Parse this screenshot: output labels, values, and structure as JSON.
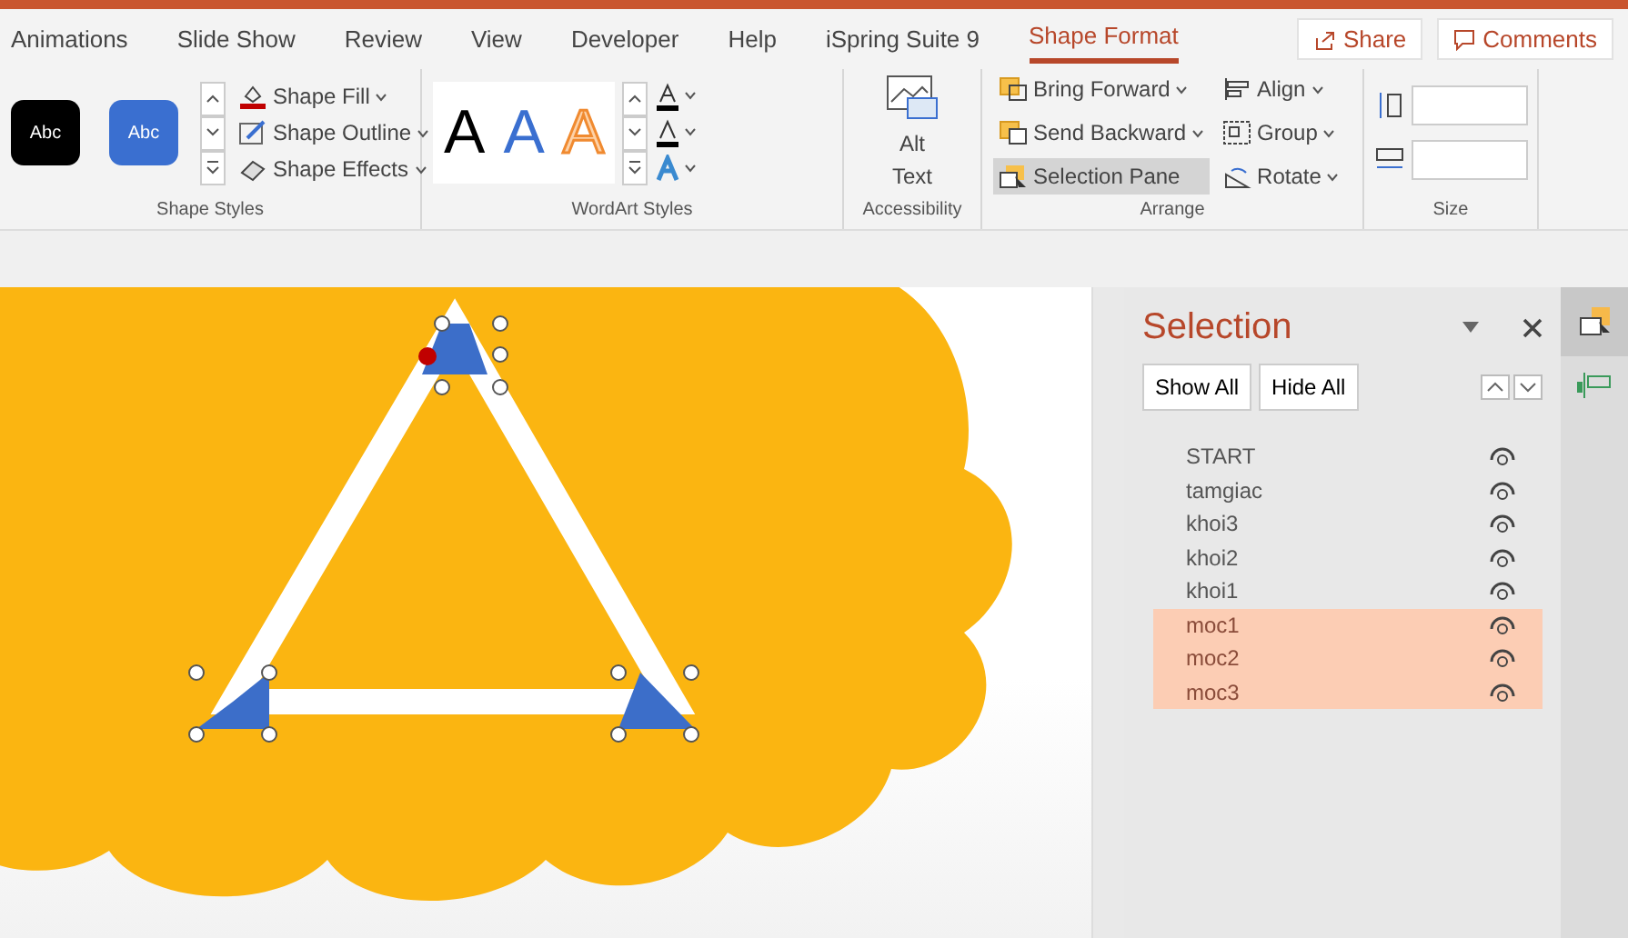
{
  "tabs": [
    {
      "label": "Animations",
      "selected": false
    },
    {
      "label": "Slide Show",
      "selected": false
    },
    {
      "label": "Review",
      "selected": false
    },
    {
      "label": "View",
      "selected": false
    },
    {
      "label": "Developer",
      "selected": false
    },
    {
      "label": "Help",
      "selected": false
    },
    {
      "label": "iSpring Suite 9",
      "selected": false
    },
    {
      "label": "Shape Format",
      "selected": true
    }
  ],
  "share_button": "Share",
  "comments_button": "Comments",
  "ribbon": {
    "shape_styles": {
      "label": "Shape Styles",
      "swatches": [
        {
          "text": "Abc",
          "color": "#000000"
        },
        {
          "text": "Abc",
          "color": "#3a6fd0"
        }
      ],
      "commands": [
        {
          "label": "Shape Fill",
          "kind": "fill"
        },
        {
          "label": "Shape Outline",
          "kind": "outline"
        },
        {
          "label": "Shape Effects",
          "kind": "effects"
        }
      ]
    },
    "wordart_styles": {
      "label": "WordArt Styles",
      "samples": [
        {
          "text": "A",
          "kind": "plain"
        },
        {
          "text": "A",
          "kind": "blue"
        },
        {
          "text": "A",
          "kind": "orange"
        }
      ]
    },
    "accessibility": {
      "label": "Accessibility",
      "button": "Alt Text"
    },
    "arrange": {
      "label": "Arrange",
      "commands": [
        {
          "label": "Bring Forward",
          "kind": "forward",
          "selected": false
        },
        {
          "label": "Send Backward",
          "kind": "backward",
          "selected": false
        },
        {
          "label": "Selection Pane",
          "kind": "pane",
          "selected": true
        }
      ],
      "side_commands": [
        {
          "label": "Align",
          "kind": "align"
        },
        {
          "label": "Group",
          "kind": "group"
        },
        {
          "label": "Rotate",
          "kind": "rotate"
        }
      ]
    },
    "size": {
      "label": "Size"
    }
  },
  "selection_pane": {
    "title": "Selection",
    "show_all": "Show All",
    "hide_all": "Hide All",
    "items": [
      {
        "name": "START",
        "selected": false
      },
      {
        "name": "tamgiac",
        "selected": false
      },
      {
        "name": "khoi3",
        "selected": false
      },
      {
        "name": "khoi2",
        "selected": false
      },
      {
        "name": "khoi1",
        "selected": false
      },
      {
        "name": "moc1",
        "selected": true
      },
      {
        "name": "moc2",
        "selected": true
      },
      {
        "name": "moc3",
        "selected": true
      }
    ]
  }
}
